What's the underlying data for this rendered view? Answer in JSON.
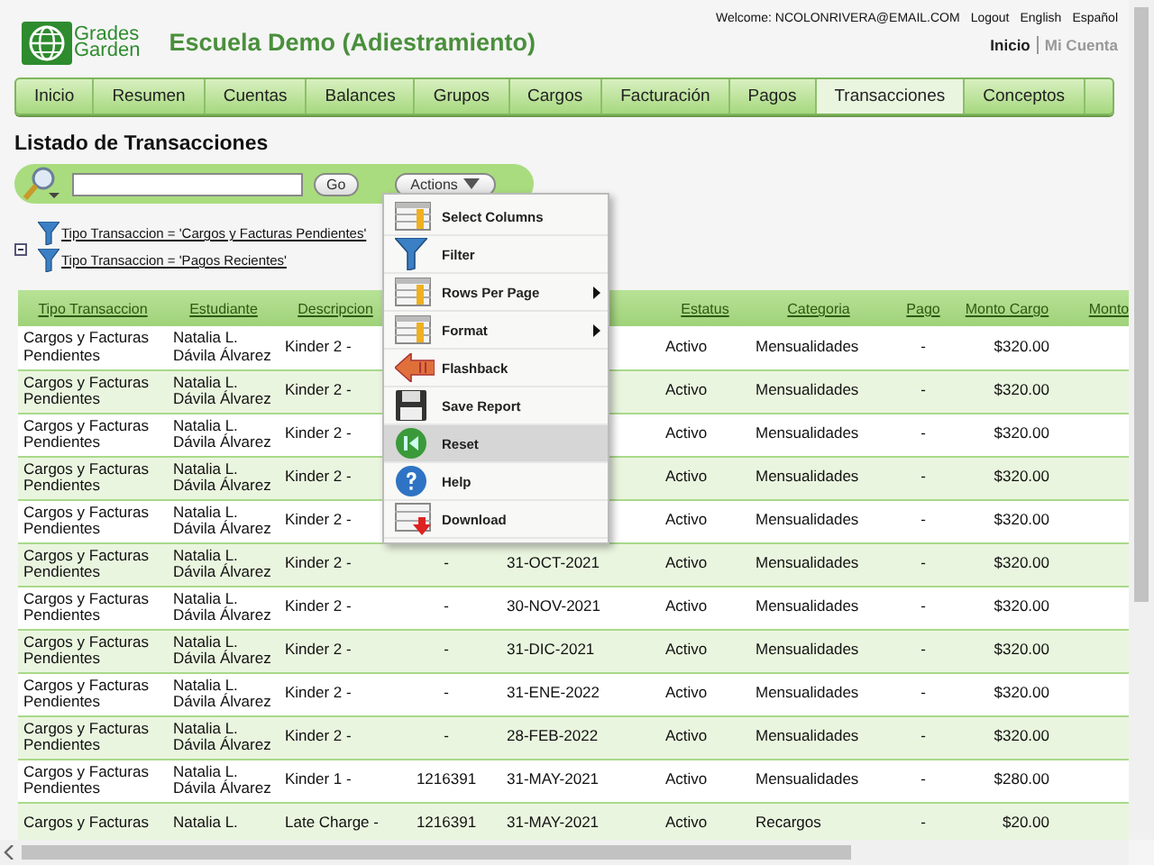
{
  "header": {
    "logo_line1": "Grades",
    "logo_line2": "Garden",
    "school": "Escuela Demo (Adiestramiento)",
    "welcome": "Welcome: NCOLONRIVERA@EMAIL.COM",
    "links": [
      "Logout",
      "English",
      "Español"
    ],
    "account_links": [
      {
        "label": "Inicio",
        "selected": true
      },
      {
        "label": "Mi Cuenta",
        "selected": false
      }
    ]
  },
  "tabs": [
    {
      "label": "Inicio",
      "selected": false
    },
    {
      "label": "Resumen",
      "selected": false
    },
    {
      "label": "Cuentas",
      "selected": false
    },
    {
      "label": "Balances",
      "selected": false
    },
    {
      "label": "Grupos",
      "selected": false
    },
    {
      "label": "Cargos",
      "selected": false
    },
    {
      "label": "Facturación",
      "selected": false
    },
    {
      "label": "Pagos",
      "selected": false
    },
    {
      "label": "Transacciones",
      "selected": true
    },
    {
      "label": "Conceptos",
      "selected": false
    }
  ],
  "page_title": "Listado de Transacciones",
  "search": {
    "go": "Go",
    "actions": "Actions"
  },
  "filters": [
    "Tipo Transaccion = 'Cargos y Facturas Pendientes'",
    "Tipo Transaccion = 'Pagos Recientes'"
  ],
  "actions_menu": [
    {
      "label": "Select Columns",
      "submenu": false,
      "highlighted": false
    },
    {
      "label": "Filter",
      "submenu": false,
      "highlighted": false
    },
    {
      "label": "Rows Per Page",
      "submenu": true,
      "highlighted": false
    },
    {
      "label": "Format",
      "submenu": true,
      "highlighted": false
    },
    {
      "label": "Flashback",
      "submenu": false,
      "highlighted": false
    },
    {
      "label": "Save Report",
      "submenu": false,
      "highlighted": false
    },
    {
      "label": "Reset",
      "submenu": false,
      "highlighted": true
    },
    {
      "label": "Help",
      "submenu": false,
      "highlighted": false
    },
    {
      "label": "Download",
      "submenu": false,
      "highlighted": false
    }
  ],
  "table": {
    "columns": [
      "Tipo Transaccion",
      "Estudiante",
      "Descripcion",
      null,
      null,
      "Estatus",
      "Categoria",
      "Pago",
      "Monto Cargo",
      "Monto"
    ],
    "rows": [
      [
        "Cargos y Facturas Pendientes",
        "Natalia L. Dávila Álvarez",
        "Kinder 2 -",
        null,
        null,
        "Activo",
        "Mensualidades",
        "-",
        "$320.00"
      ],
      [
        "Cargos y Facturas Pendientes",
        "Natalia L. Dávila Álvarez",
        "Kinder 2 -",
        null,
        null,
        "Activo",
        "Mensualidades",
        "-",
        "$320.00"
      ],
      [
        "Cargos y Facturas Pendientes",
        "Natalia L. Dávila Álvarez",
        "Kinder 2 -",
        null,
        null,
        "Activo",
        "Mensualidades",
        "-",
        "$320.00"
      ],
      [
        "Cargos y Facturas Pendientes",
        "Natalia L. Dávila Álvarez",
        "Kinder 2 -",
        null,
        null,
        "Activo",
        "Mensualidades",
        "-",
        "$320.00"
      ],
      [
        "Cargos y Facturas Pendientes",
        "Natalia L. Dávila Álvarez",
        "Kinder 2 -",
        null,
        null,
        "Activo",
        "Mensualidades",
        "-",
        "$320.00"
      ],
      [
        "Cargos y Facturas Pendientes",
        "Natalia L. Dávila Álvarez",
        "Kinder 2 -",
        "-",
        "31-OCT-2021",
        "Activo",
        "Mensualidades",
        "-",
        "$320.00"
      ],
      [
        "Cargos y Facturas Pendientes",
        "Natalia L. Dávila Álvarez",
        "Kinder 2 -",
        "-",
        "30-NOV-2021",
        "Activo",
        "Mensualidades",
        "-",
        "$320.00"
      ],
      [
        "Cargos y Facturas Pendientes",
        "Natalia L. Dávila Álvarez",
        "Kinder 2 -",
        "-",
        "31-DIC-2021",
        "Activo",
        "Mensualidades",
        "-",
        "$320.00"
      ],
      [
        "Cargos y Facturas Pendientes",
        "Natalia L. Dávila Álvarez",
        "Kinder 2 -",
        "-",
        "31-ENE-2022",
        "Activo",
        "Mensualidades",
        "-",
        "$320.00"
      ],
      [
        "Cargos y Facturas Pendientes",
        "Natalia L. Dávila Álvarez",
        "Kinder 2 -",
        "-",
        "28-FEB-2022",
        "Activo",
        "Mensualidades",
        "-",
        "$320.00"
      ],
      [
        "Cargos y Facturas Pendientes",
        "Natalia L. Dávila Álvarez",
        "Kinder 1 -",
        "1216391",
        "31-MAY-2021",
        "Activo",
        "Mensualidades",
        "-",
        "$280.00"
      ],
      [
        "Cargos y Facturas",
        "Natalia L.",
        "Late Charge -",
        "1216391",
        "31-MAY-2021",
        "Activo",
        "Recargos",
        "-",
        "$20.00"
      ]
    ]
  }
}
